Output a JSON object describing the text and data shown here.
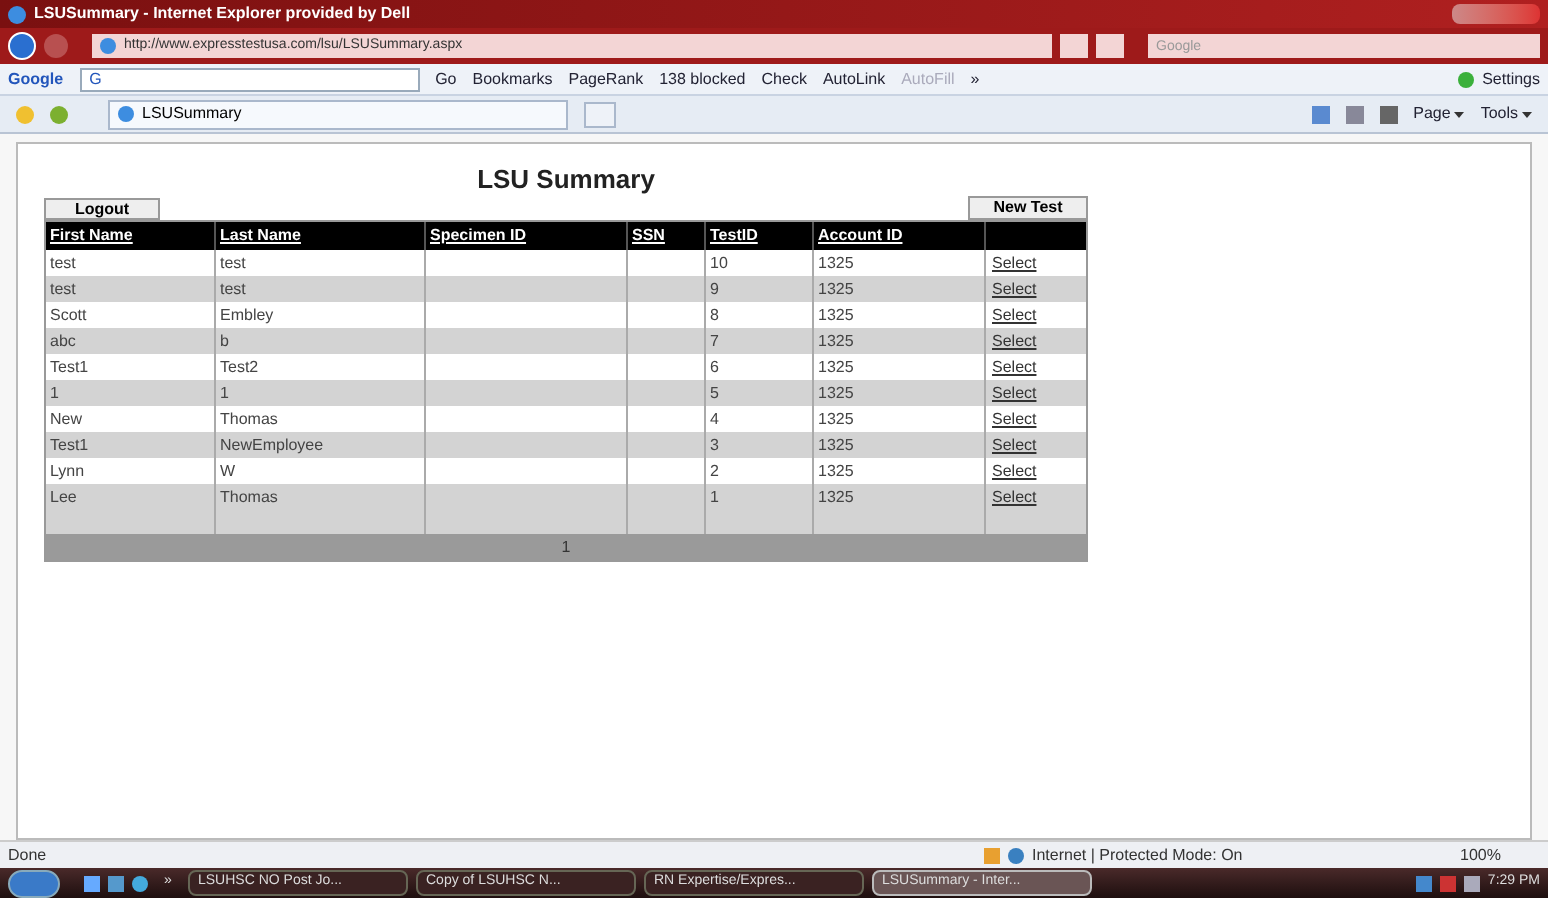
{
  "window": {
    "title": "LSUSummary - Internet Explorer provided by Dell"
  },
  "address_bar": {
    "url": "http://www.expresstestusa.com/lsu/LSUSummary.aspx",
    "search_placeholder": "Google"
  },
  "google_toolbar": {
    "logo": "Google",
    "field": "G",
    "items": [
      {
        "label": "Go",
        "disabled": false
      },
      {
        "label": "Bookmarks",
        "disabled": false
      },
      {
        "label": "PageRank",
        "disabled": false
      },
      {
        "label": "138 blocked",
        "disabled": false
      },
      {
        "label": "Check",
        "disabled": false
      },
      {
        "label": "AutoLink",
        "disabled": false
      },
      {
        "label": "AutoFill",
        "disabled": true
      }
    ],
    "more": "»",
    "settings": "Settings"
  },
  "tab": {
    "title": "LSUSummary"
  },
  "command_bar": [
    "Page",
    "Tools"
  ],
  "page": {
    "title": "LSU Summary",
    "logout": "Logout",
    "new_test": "New Test",
    "columns": [
      "First Name",
      "Last Name",
      "Specimen ID",
      "SSN",
      "TestID",
      "Account ID"
    ],
    "rows": [
      {
        "first": "test",
        "last": "test",
        "specimen": "",
        "ssn": "",
        "test_id": "10",
        "account": "1325",
        "action": "Select"
      },
      {
        "first": "test",
        "last": "test",
        "specimen": "",
        "ssn": "",
        "test_id": "9",
        "account": "1325",
        "action": "Select"
      },
      {
        "first": "Scott",
        "last": "Embley",
        "specimen": "",
        "ssn": "",
        "test_id": "8",
        "account": "1325",
        "action": "Select"
      },
      {
        "first": "abc",
        "last": "b",
        "specimen": "",
        "ssn": "",
        "test_id": "7",
        "account": "1325",
        "action": "Select"
      },
      {
        "first": "Test1",
        "last": "Test2",
        "specimen": "",
        "ssn": "",
        "test_id": "6",
        "account": "1325",
        "action": "Select"
      },
      {
        "first": "1",
        "last": "1",
        "specimen": "",
        "ssn": "",
        "test_id": "5",
        "account": "1325",
        "action": "Select"
      },
      {
        "first": "New",
        "last": "Thomas",
        "specimen": "",
        "ssn": "",
        "test_id": "4",
        "account": "1325",
        "action": "Select"
      },
      {
        "first": "Test1",
        "last": "NewEmployee",
        "specimen": "",
        "ssn": "",
        "test_id": "3",
        "account": "1325",
        "action": "Select"
      },
      {
        "first": "Lynn",
        "last": "W",
        "specimen": "",
        "ssn": "",
        "test_id": "2",
        "account": "1325",
        "action": "Select"
      },
      {
        "first": "Lee",
        "last": "Thomas",
        "specimen": "",
        "ssn": "",
        "test_id": "1",
        "account": "1325",
        "action": "Select"
      }
    ],
    "pager": "1"
  },
  "status_bar": {
    "status": "Done",
    "zone": "Internet | Protected Mode: On",
    "zoom": "100%"
  },
  "taskbar": {
    "items": [
      {
        "label": "LSUHSC NO Post Jo...",
        "selected": false
      },
      {
        "label": "Copy of LSUHSC N...",
        "selected": false
      },
      {
        "label": "RN Expertise/Expres...",
        "selected": false
      },
      {
        "label": "LSUSummary - Inter...",
        "selected": true
      }
    ],
    "more": "»",
    "time": "7:29 PM"
  }
}
